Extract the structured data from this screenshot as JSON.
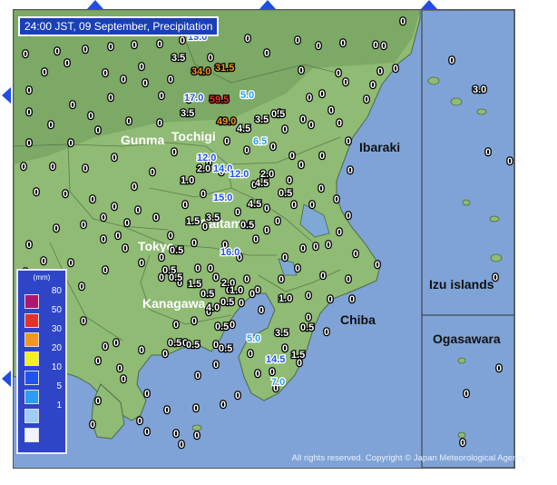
{
  "title": "24:00 JST, 09 September, Precipitation",
  "copyright": "All rights reserved. Copyright © Japan Meteorological Agency",
  "colors": {
    "sea": "#7fa3d6",
    "land": "#8fbb74",
    "mountain": "#6e9b5b",
    "lake": "#7ea8d6"
  },
  "legend": {
    "unit": "(mm)",
    "items": [
      {
        "label": "80",
        "color": "#b0166e"
      },
      {
        "label": "50",
        "color": "#e8302a"
      },
      {
        "label": "30",
        "color": "#f5961e"
      },
      {
        "label": "20",
        "color": "#f5ef1c"
      },
      {
        "label": "10",
        "color": "#1e53f0"
      },
      {
        "label": "5",
        "color": "#2c9df2"
      },
      {
        "label": "1",
        "color": "#9fcdf6"
      },
      {
        "label": "",
        "color": "#f3f3ff"
      }
    ]
  },
  "places": [
    {
      "name": "Gunma"
    },
    {
      "name": "Tochigi"
    },
    {
      "name": "Ibaraki"
    },
    {
      "name": "Saitama"
    },
    {
      "name": "Tokyo"
    },
    {
      "name": "Kanagawa"
    },
    {
      "name": "Chiba"
    },
    {
      "name": "Izu islands"
    },
    {
      "name": "Ogasawara"
    }
  ],
  "readings": [
    {
      "v": "19.0",
      "lvl": 2
    },
    {
      "v": "3.5",
      "lvl": 0
    },
    {
      "v": "34.0",
      "lvl": 4
    },
    {
      "v": "31.5",
      "lvl": 4
    },
    {
      "v": "17.0",
      "lvl": 2
    },
    {
      "v": "59.5",
      "lvl": 5
    },
    {
      "v": "5.0",
      "lvl": 1
    },
    {
      "v": "3.5",
      "lvl": 0
    },
    {
      "v": "49.0",
      "lvl": 4
    },
    {
      "v": "4.5",
      "lvl": 0
    },
    {
      "v": "3.5",
      "lvl": 0
    },
    {
      "v": "0.5",
      "lvl": 0
    },
    {
      "v": "6.5",
      "lvl": 1
    },
    {
      "v": "12.0",
      "lvl": 2
    },
    {
      "v": "2.0",
      "lvl": 0
    },
    {
      "v": "14.0",
      "lvl": 2
    },
    {
      "v": "12.0",
      "lvl": 2
    },
    {
      "v": "2.0",
      "lvl": 0
    },
    {
      "v": "4.5",
      "lvl": 0
    },
    {
      "v": "1.0",
      "lvl": 0
    },
    {
      "v": "15.0",
      "lvl": 2
    },
    {
      "v": "4.5",
      "lvl": 0
    },
    {
      "v": "0.5",
      "lvl": 0
    },
    {
      "v": "1.5",
      "lvl": 0
    },
    {
      "v": "3.5",
      "lvl": 0
    },
    {
      "v": "0.5",
      "lvl": 0
    },
    {
      "v": "16.0",
      "lvl": 2
    },
    {
      "v": "0.5",
      "lvl": 0
    },
    {
      "v": "1.5",
      "lvl": 0
    },
    {
      "v": "2.0",
      "lvl": 0
    },
    {
      "v": "0.5",
      "lvl": 0
    },
    {
      "v": "1.0",
      "lvl": 0
    },
    {
      "v": "4.0",
      "lvl": 0
    },
    {
      "v": "0.5",
      "lvl": 0
    },
    {
      "v": "0.5",
      "lvl": 0
    },
    {
      "v": "5.0",
      "lvl": 1
    },
    {
      "v": "3.5",
      "lvl": 0
    },
    {
      "v": "0.5",
      "lvl": 0
    },
    {
      "v": "14.5",
      "lvl": 2
    },
    {
      "v": "1.5",
      "lvl": 0
    },
    {
      "v": "7.0",
      "lvl": 1
    },
    {
      "v": "0.5",
      "lvl": 0
    },
    {
      "v": "3.0",
      "lvl": 0
    },
    {
      "v": "0.5",
      "lvl": 0
    },
    {
      "v": "1.0",
      "lvl": 0
    },
    {
      "v": "0.5",
      "lvl": 0
    },
    {
      "v": "0.5",
      "lvl": 0
    },
    {
      "v": "0.5",
      "lvl": 0
    }
  ],
  "zero_label": "0"
}
